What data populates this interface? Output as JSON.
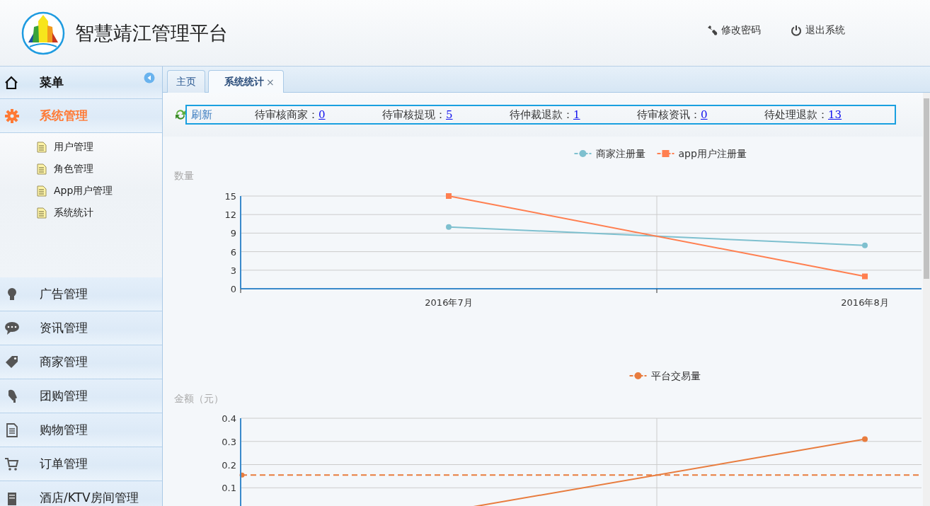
{
  "header": {
    "title": "智慧靖江管理平台",
    "actions": [
      "修改密码",
      "退出系统"
    ]
  },
  "sidebar": {
    "title": "菜单",
    "groups": [
      {
        "label": "系统管理",
        "selected": true,
        "expanded": true,
        "children": [
          {
            "label": "用户管理"
          },
          {
            "label": "角色管理"
          },
          {
            "label": "App用户管理"
          },
          {
            "label": "系统统计"
          }
        ]
      },
      {
        "label": "广告管理",
        "selected": false
      },
      {
        "label": "资讯管理",
        "selected": false
      },
      {
        "label": "商家管理",
        "selected": false
      },
      {
        "label": "团购管理",
        "selected": false
      },
      {
        "label": "购物管理",
        "selected": false
      },
      {
        "label": "订单管理",
        "selected": false
      },
      {
        "label": "酒店/KTV房间管理",
        "selected": false
      }
    ]
  },
  "tabs": [
    {
      "label": "主页",
      "selected": false
    },
    {
      "label": "系统统计",
      "selected": true,
      "close": "×"
    }
  ],
  "toolbar": {
    "refresh": "刷新",
    "stats": [
      {
        "label": "待审核商家：",
        "value": "0"
      },
      {
        "label": "待审核提现：",
        "value": "5"
      },
      {
        "label": "待仲裁退款：",
        "value": "1"
      },
      {
        "label": "待审核资讯：",
        "value": "0"
      },
      {
        "label": "待处理退款：",
        "value": "13"
      }
    ]
  },
  "charts": [
    {
      "chart_data": {
        "type": "line",
        "ylabel": "数量",
        "categories": [
          "2016年7月",
          "2016年8月"
        ],
        "legend": "top",
        "grid": true,
        "series": [
          {
            "name": "商家注册量",
            "color": "#7ec0cf",
            "marker": "circle",
            "values": [
              10,
              7
            ]
          },
          {
            "name": "app用户注册量",
            "color": "#ff7f50",
            "marker": "square",
            "values": [
              15,
              2
            ]
          }
        ],
        "ylim": [
          0,
          15
        ],
        "yticks": [
          0,
          3,
          6,
          9,
          12,
          15
        ]
      }
    },
    {
      "chart_data": {
        "type": "line",
        "ylabel": "金额（元）",
        "legend": "top",
        "grid": true,
        "series": [
          {
            "name": "平台交易量",
            "color": "#e87c3e",
            "marker": "circle",
            "values": [
              0,
              0.31
            ]
          }
        ],
        "ylim": [
          0,
          0.4
        ],
        "yticks": [
          0.1,
          0.2,
          0.3,
          0.4
        ],
        "ref_lines": [
          {
            "axis": "y",
            "value": 0.155,
            "color": "#e87c3e"
          }
        ]
      }
    }
  ]
}
